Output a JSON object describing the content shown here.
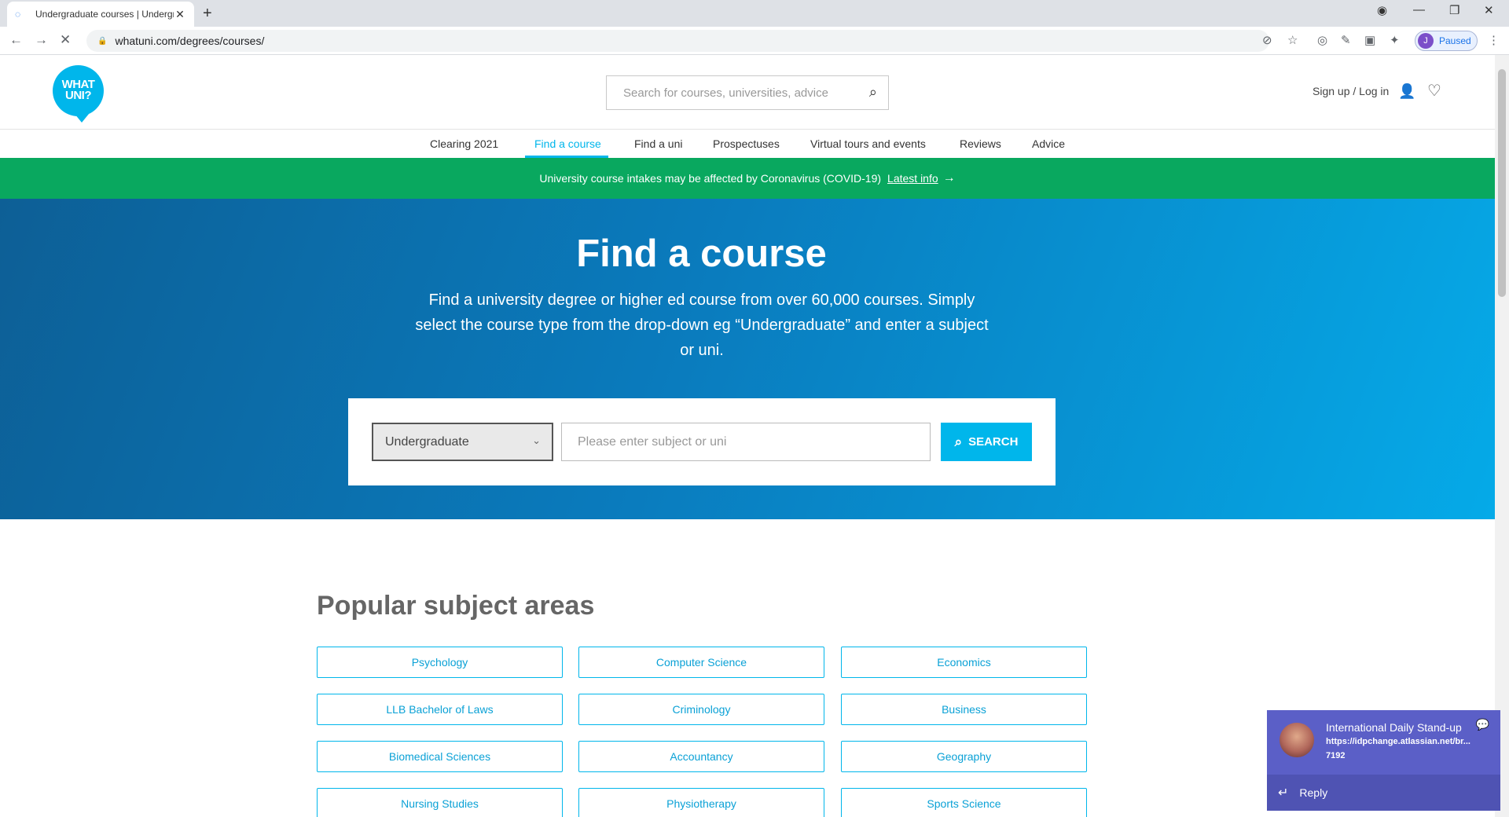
{
  "browser": {
    "tab_title": "Undergraduate courses | Undergr",
    "url": "whatuni.com/degrees/courses/",
    "profile_initial": "J",
    "profile_status": "Paused"
  },
  "header": {
    "logo_line1": "WHAT",
    "logo_line2": "UNI?",
    "search_placeholder": "Search for courses, universities, advice",
    "signin": "Sign up / Log in"
  },
  "nav": {
    "items": [
      "Clearing 2021",
      "Find a course",
      "Find a uni",
      "Prospectuses",
      "Virtual tours and events",
      "Reviews",
      "Advice"
    ],
    "active": "Find a course"
  },
  "banner": {
    "text": "University course intakes may be affected by Coronavirus (COVID-19)",
    "link": "Latest info"
  },
  "hero": {
    "title": "Find a course",
    "description": "Find a university degree or higher ed course from over 60,000 courses. Simply select the course type from the drop-down eg “Undergraduate” and enter a subject or uni.",
    "course_type": "Undergraduate",
    "subject_placeholder": "Please enter subject or uni",
    "search_label": "SEARCH"
  },
  "popular": {
    "title": "Popular subject areas",
    "subjects": [
      "Psychology",
      "Computer Science",
      "Economics",
      "LLB Bachelor of Laws",
      "Criminology",
      "Business",
      "Biomedical Sciences",
      "Accountancy",
      "Geography",
      "Nursing Studies",
      "Physiotherapy",
      "Sports Science"
    ]
  },
  "notification": {
    "title": "International Daily Stand-up",
    "line2": "https://idpchange.atlassian.net/br...",
    "line3": "7192",
    "reply": "Reply"
  },
  "colors": {
    "brand": "#00b6eb",
    "banner": "#09a85f",
    "toast": "#5b5fc7"
  }
}
